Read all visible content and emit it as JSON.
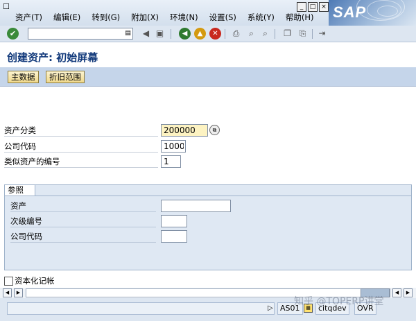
{
  "menubar": {
    "items": [
      "资产(T)",
      "编辑(E)",
      "转到(G)",
      "附加(X)",
      "环境(N)",
      "设置(S)",
      "系统(Y)",
      "帮助(H)"
    ],
    "logo": "SAP"
  },
  "toolbar": {
    "command_value": "",
    "icons": [
      "enter-icon",
      "history-icon",
      "back-arrow-icon",
      "save-icon",
      "back-icon",
      "exit-icon",
      "cancel-icon",
      "print-icon",
      "find-icon",
      "find-next-icon",
      "first-page-icon",
      "prev-page-icon",
      "next-page-icon",
      "last-page-icon",
      "new-session-icon",
      "shortcut-icon",
      "help-icon"
    ]
  },
  "page": {
    "title": "创建资产: 初始屏幕"
  },
  "app_toolbar": {
    "buttons": [
      "主数据",
      "折旧范围"
    ]
  },
  "fields": {
    "asset_class": {
      "label": "资产分类",
      "value": "200000"
    },
    "company_code": {
      "label": "公司代码",
      "value": "1000"
    },
    "similar_assets": {
      "label": "类似资产的编号",
      "value": "1"
    }
  },
  "reference": {
    "title": "参照",
    "asset": {
      "label": "资产",
      "value": ""
    },
    "subnumber": {
      "label": "次级编号",
      "value": ""
    },
    "company_code": {
      "label": "公司代码",
      "value": ""
    }
  },
  "capitalization": {
    "label": "资本化记帐",
    "checked": false
  },
  "statusbar": {
    "system": "AS01",
    "server": "citqdev",
    "mode": "OVR"
  },
  "watermark": "知乎 @TOPERP讲堂",
  "colors": {
    "title": "#10387a",
    "required_field": "#fdf3c2",
    "button": "#f1d98b"
  }
}
